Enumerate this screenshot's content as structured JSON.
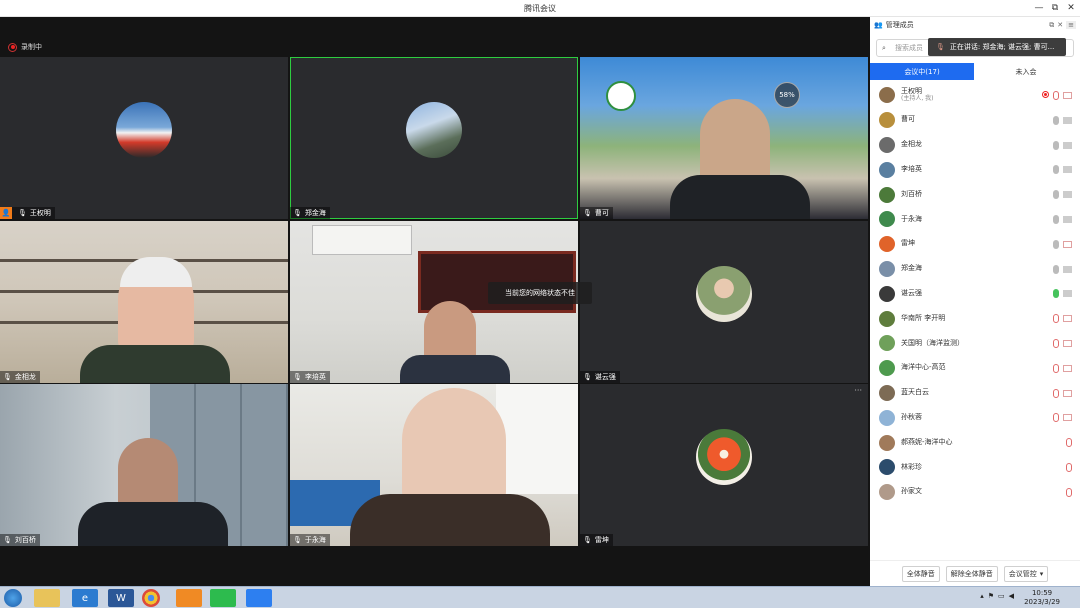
{
  "window": {
    "title": "腾讯会议",
    "controls": [
      "—",
      "⧉",
      "✕"
    ]
  },
  "recording": {
    "label": "录制中"
  },
  "toast": "当前您的网络状态不佳",
  "badge": {
    "percent": "58%"
  },
  "tiles": [
    {
      "name": "王权明",
      "host": true,
      "active": false,
      "type": "avatar"
    },
    {
      "name": "郑金海",
      "host": false,
      "active": true,
      "type": "avatar"
    },
    {
      "name": "曹可",
      "host": false,
      "active": false,
      "type": "video"
    },
    {
      "name": "金相龙",
      "host": false,
      "active": false,
      "type": "video"
    },
    {
      "name": "李培英",
      "host": false,
      "active": false,
      "type": "video"
    },
    {
      "name": "谌云强",
      "host": false,
      "active": false,
      "type": "avatar"
    },
    {
      "name": "刘百桥",
      "host": false,
      "active": false,
      "type": "video"
    },
    {
      "name": "于永海",
      "host": false,
      "active": false,
      "type": "video"
    },
    {
      "name": "雷坤",
      "host": false,
      "active": false,
      "type": "avatar"
    }
  ],
  "panel": {
    "title": "管理成员",
    "search_placeholder": "搜索成员",
    "speaking": "正在讲话: 郑金海; 谌云强; 曹可...",
    "tab_in": "会议中(17)",
    "tab_out": "未入会",
    "members": [
      {
        "name": "王权明",
        "sub": "(主持人, 我)",
        "mic": "off",
        "cam": "off",
        "rec": true,
        "color": "#8b6d4b"
      },
      {
        "name": "曹可",
        "sub": "",
        "mic": "normal",
        "cam": "normal",
        "rec": false,
        "color": "#b88f3c"
      },
      {
        "name": "金相龙",
        "sub": "",
        "mic": "normal",
        "cam": "normal",
        "rec": false,
        "color": "#6b6b6b"
      },
      {
        "name": "李培英",
        "sub": "",
        "mic": "normal",
        "cam": "normal",
        "rec": false,
        "color": "#5a7fa0"
      },
      {
        "name": "刘百桥",
        "sub": "",
        "mic": "normal",
        "cam": "normal",
        "rec": false,
        "color": "#4c7a3a"
      },
      {
        "name": "于永海",
        "sub": "",
        "mic": "normal",
        "cam": "normal",
        "rec": false,
        "color": "#3f8a4d"
      },
      {
        "name": "雷坤",
        "sub": "",
        "mic": "normal",
        "cam": "off",
        "rec": false,
        "color": "#e0632a"
      },
      {
        "name": "郑金海",
        "sub": "",
        "mic": "normal",
        "cam": "normal",
        "rec": false,
        "color": "#7a8fa8"
      },
      {
        "name": "谌云强",
        "sub": "",
        "mic": "on",
        "cam": "normal",
        "rec": false,
        "color": "#3a3a3a"
      },
      {
        "name": "华南所 李开明",
        "sub": "",
        "mic": "off",
        "cam": "off",
        "rec": false,
        "color": "#5f7d3d"
      },
      {
        "name": "关国明（海洋监测）",
        "sub": "",
        "mic": "off",
        "cam": "off",
        "rec": false,
        "color": "#6fa05a"
      },
      {
        "name": "海洋中心-高范",
        "sub": "",
        "mic": "off",
        "cam": "off",
        "rec": false,
        "color": "#4e9a4e"
      },
      {
        "name": "蓝天白云",
        "sub": "",
        "mic": "off",
        "cam": "off",
        "rec": false,
        "color": "#7d6b55"
      },
      {
        "name": "孙秋蓉",
        "sub": "",
        "mic": "off",
        "cam": "off",
        "rec": false,
        "color": "#8fb3d6"
      },
      {
        "name": "郝燕妮-海洋中心",
        "sub": "",
        "mic": "off",
        "cam": "none",
        "rec": false,
        "color": "#a07a5a"
      },
      {
        "name": "林彩珍",
        "sub": "",
        "mic": "off",
        "cam": "none",
        "rec": false,
        "color": "#2c4c6c"
      },
      {
        "name": "孙家文",
        "sub": "",
        "mic": "off",
        "cam": "none",
        "rec": false,
        "color": "#b09a8a"
      }
    ],
    "mute_all": "全体静音",
    "unmute_all": "解除全体静音",
    "settings": "会议管控"
  },
  "taskbar": {
    "time": "10:59",
    "date": "2023/3/29",
    "apps": [
      "start",
      "folder",
      "ie",
      "word",
      "chrome",
      "app-orange",
      "wechat",
      "tencent-meeting"
    ]
  }
}
